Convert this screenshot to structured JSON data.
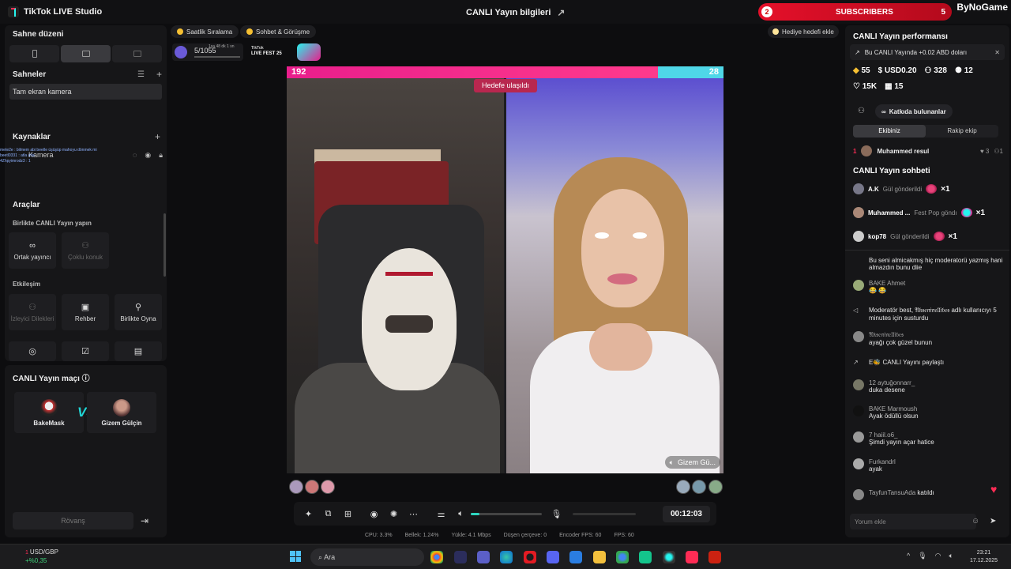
{
  "app": {
    "title": "TikTok LIVE Studio",
    "center_title": "CANLI Yayın bilgileri"
  },
  "subscribers_banner": {
    "badge": "2",
    "label": "SUBSCRIBERS",
    "count": "5",
    "brand": "ByNoGame"
  },
  "left": {
    "scene_layout": "Sahne düzeni",
    "scenes": "Sahneler",
    "scene_item": "Tam ekran kamera",
    "sources": "Kaynaklar",
    "source_item": "Kamera",
    "tools": "Araçlar",
    "collab_header": "Birlikte CANLI Yayın yapın",
    "collab_tools": [
      {
        "label": "Ortak yayıncı",
        "disabled": false
      },
      {
        "label": "Çoklu konuk",
        "disabled": true
      }
    ],
    "interaction_header": "Etkileşim",
    "interaction_tools": [
      {
        "label": "İzleyici Dilekleri",
        "disabled": true
      },
      {
        "label": "Rehber",
        "disabled": false
      },
      {
        "label": "Birlikte Oyna",
        "disabled": false
      }
    ],
    "overlay_chat": [
      "mete2e : bilmem abi beetle üşüşüp mahoyu dönmek mi",
      "beetl0331 : atla atla",
      "4Zhpyimrodz3 : 1"
    ]
  },
  "match": {
    "title": "CANLI Yayın maçı",
    "host": "BakeMask",
    "opponent": "Gizem Gülçin",
    "vs": "VS",
    "rematch": "Rövanş"
  },
  "top_chips": {
    "hourly": "Saatlik Sıralama",
    "chat": "Sohbet & Görüşme",
    "progress": "5/1055",
    "progress_sub": "1sa 48 dk 1 sn",
    "fest_line1": "TikTok",
    "fest_line2": "LIVE FEST 25",
    "gift_goal": "Hediye hedefi ekle"
  },
  "battle": {
    "left_score": "192",
    "right_score": "28",
    "goal_reached": "Hedefe ulaşıldı",
    "right_name": "Gizem Gü...",
    "left_share": 0.87
  },
  "controls": {
    "timer": "00:12:03",
    "volume": 0.12
  },
  "stats": [
    "CPU: 3.3%",
    "Bellek: 1.24%",
    "Yükle: 4.1 Mbps",
    "Düşen çerçeve: 0",
    "Encoder FPS: 60",
    "FPS: 60"
  ],
  "right": {
    "perf_title": "CANLI Yayın performansı",
    "earn_note": "Bu CANLI Yayında +0.02 ABD doları",
    "metrics1": [
      "55",
      "USD0.20",
      "328",
      "12"
    ],
    "metrics2": [
      "15K",
      "15"
    ],
    "contributors": "Katkıda bulunanlar",
    "team_tabs": [
      "Ekibiniz",
      "Rakip ekip"
    ],
    "rank": {
      "num": "1",
      "name": "Muhammed resul",
      "hearts": "3",
      "count": "1"
    },
    "chat_title": "CANLI Yayın sohbeti",
    "gifts": [
      {
        "name": "A.K",
        "action": "Gül gönderildi",
        "mult": "×1"
      },
      {
        "name": "Muhammed ...",
        "action": "Fest Pop göndı",
        "mult": "×1"
      },
      {
        "name": "kop78",
        "action": "Gül gönderildi",
        "mult": "×1"
      }
    ],
    "messages": [
      {
        "name": "",
        "text": "Bu seni almicakmış hiç moderatorü yazmış hani almazdın bunu diie"
      },
      {
        "name": "BAKE Ahmet",
        "text": "😂 😂"
      },
      {
        "name": "Moderatör",
        "text": "best, 𝔄𝔨𝔰𝔢𝔫𝔦𝔫𝔢𝔩𝔩𝔦𝔟𝔢𝔰 adlı kullanıcıyı 5 minutes için susturdu"
      },
      {
        "name": "𝔄𝔨𝔰𝔢𝔫𝔦𝔫𝔢𝔩𝔩𝔦𝔟𝔢𝔰",
        "text": "ayağı çok güzel bunun"
      },
      {
        "name": "E🐝",
        "text": "CANLI Yayını paylaştı"
      },
      {
        "name": "12 aytuğonnarr_",
        "text": "duka desene"
      },
      {
        "name": "BAKE Marmoush",
        "text": "Ayak ödüllü olsun"
      },
      {
        "name": "7 haiil.o6_",
        "text": "Şimdi yayın açar hatice"
      },
      {
        "name": "Furkandrl",
        "text": "ayak"
      },
      {
        "name": "TayfunTansuAda",
        "text": "katıldı"
      }
    ],
    "comment_placeholder": "Yorum ekle"
  },
  "taskbar": {
    "ticker_name": "USD/GBP",
    "ticker_change": "+%0,35",
    "ticker_badge": "1",
    "search": "Ara",
    "time": "23:21",
    "date": "17.12.2025"
  }
}
